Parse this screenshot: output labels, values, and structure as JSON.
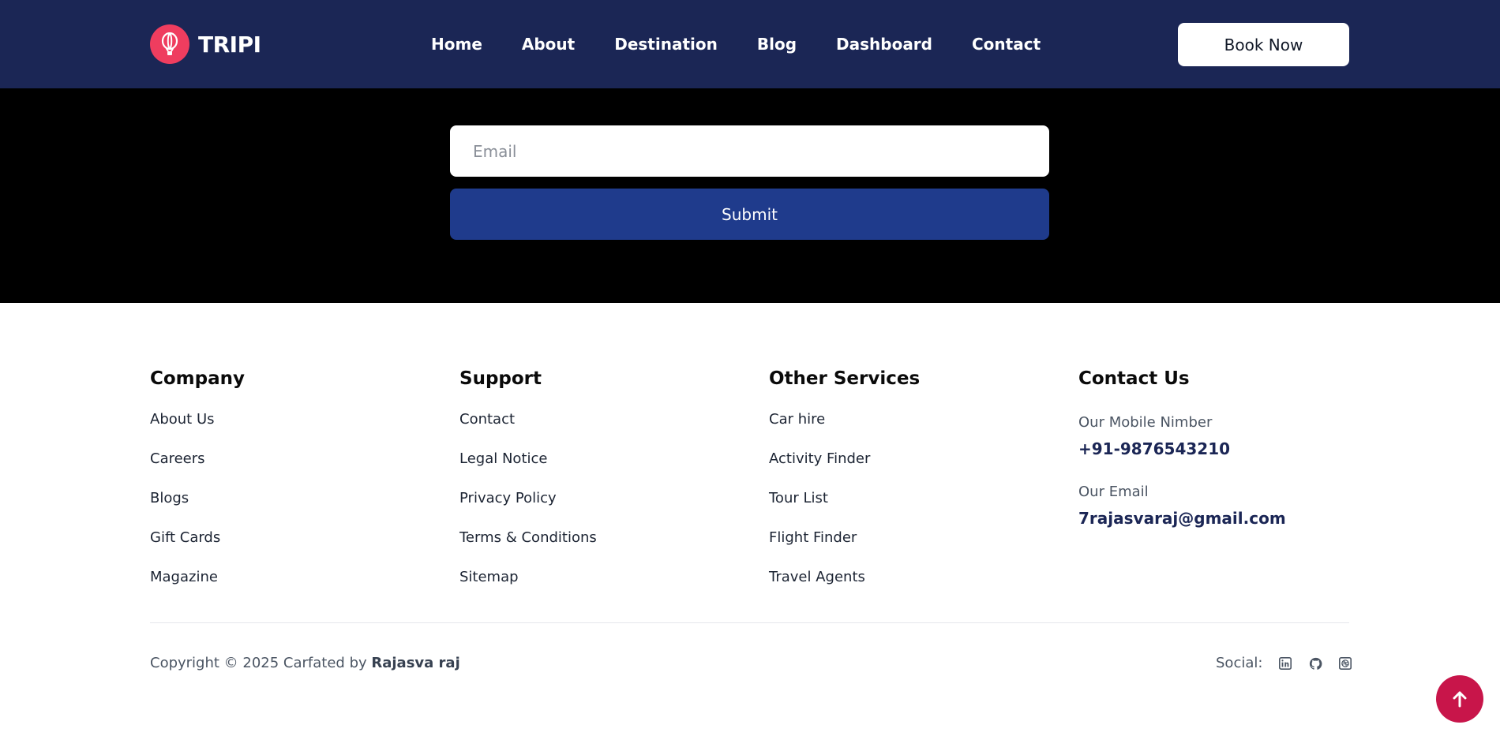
{
  "header": {
    "logo_text": "TRIPI",
    "logo_icon": "hot-air-balloon-icon",
    "nav": [
      {
        "label": "Home"
      },
      {
        "label": "About"
      },
      {
        "label": "Destination"
      },
      {
        "label": "Blog"
      },
      {
        "label": "Dashboard"
      },
      {
        "label": "Contact"
      }
    ],
    "book_now": "Book Now"
  },
  "newsletter": {
    "email_placeholder": "Email",
    "submit_label": "Submit"
  },
  "footer": {
    "company": {
      "title": "Company",
      "items": [
        "About Us",
        "Careers",
        "Blogs",
        "Gift Cards",
        "Magazine"
      ]
    },
    "support": {
      "title": "Support",
      "items": [
        "Contact",
        "Legal Notice",
        "Privacy Policy",
        "Terms & Conditions",
        "Sitemap"
      ]
    },
    "services": {
      "title": "Other Services",
      "items": [
        "Car hire",
        "Activity Finder",
        "Tour List",
        "Flight Finder",
        "Travel Agents"
      ]
    },
    "contact": {
      "title": "Contact Us",
      "mobile_label": "Our Mobile Nimber",
      "mobile_value": "+91-9876543210",
      "email_label": "Our Email",
      "email_value": "7rajasvaraj@gmail.com"
    },
    "copyright_prefix": "Copyright © 2025 Carfated by ",
    "copyright_author": "Rajasva raj",
    "social_label": "Social:",
    "social_icons": [
      "linkedin-icon",
      "github-icon",
      "dribbble-icon"
    ]
  },
  "scroll_top_icon": "arrow-up-icon",
  "colors": {
    "header_bg": "#1b2655",
    "brand_red": "#ef3d5f",
    "submit_blue": "#1f3b8c",
    "scroll_top": "#c8154a"
  }
}
